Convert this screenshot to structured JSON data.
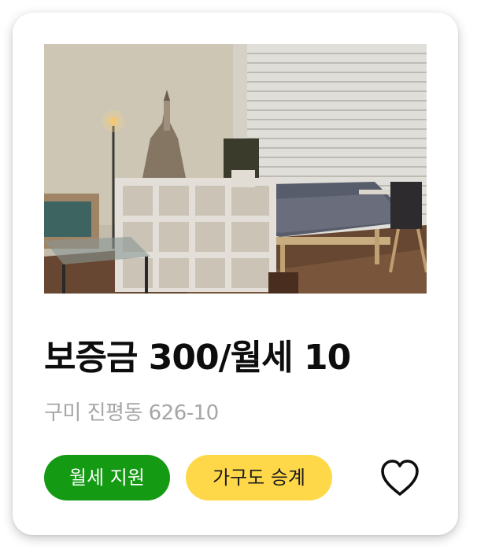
{
  "listing": {
    "price_label": "보증금 300/월세 10",
    "address": "구미 진평동 626-10",
    "tags": [
      "월세 지원",
      "가구도 승계"
    ],
    "favorite_icon": "heart-outline-icon",
    "colors": {
      "tag_green": "#149a13",
      "tag_yellow": "#ffd84a",
      "address_gray": "#a6a6a6"
    }
  }
}
